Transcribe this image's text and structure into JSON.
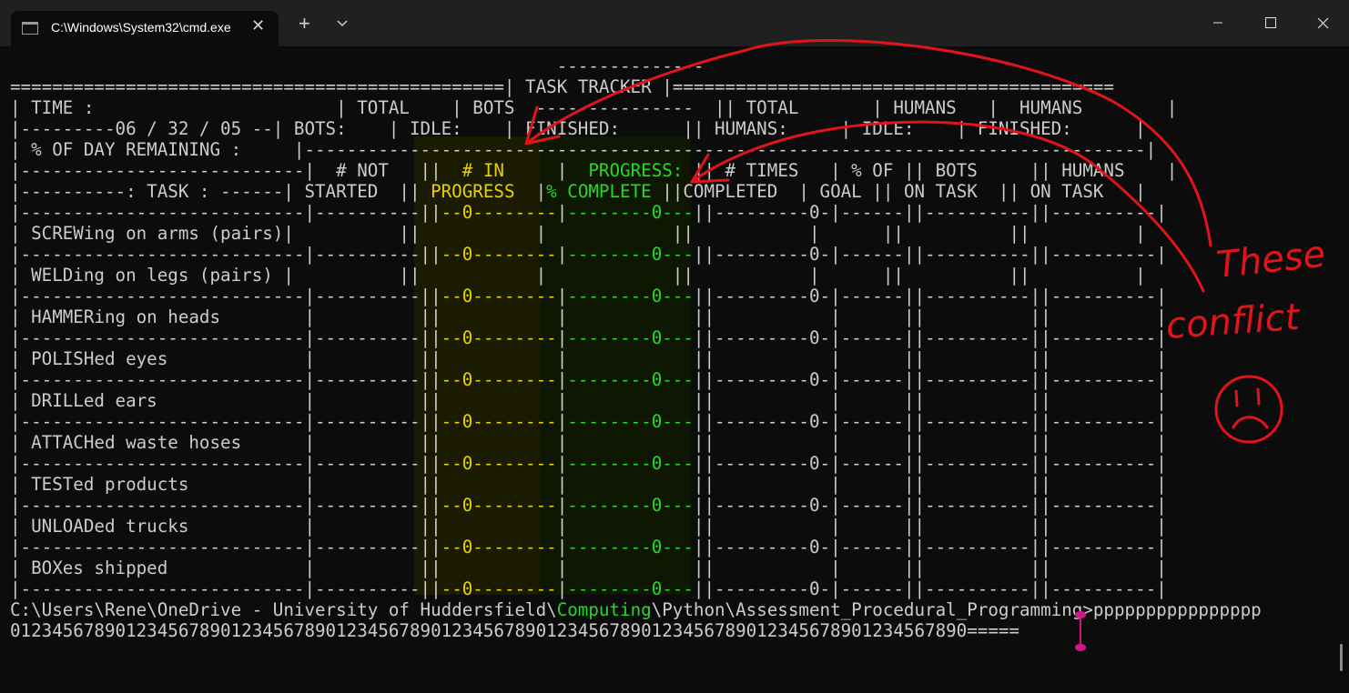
{
  "window": {
    "tab_title": "C:\\Windows\\System32\\cmd.exe",
    "tab_close": "✕",
    "new_tab": "+"
  },
  "terminal": {
    "lines": [
      [
        {
          "t": "                                                    --------------"
        }
      ],
      [
        {
          "t": "===============================================| TASK TRACKER |=========================================="
        }
      ],
      [
        {
          "t": "| TIME :                       | TOTAL    | BOTS  ---------------  || TOTAL       | HUMANS   |  HUMANS        |"
        }
      ],
      [
        {
          "t": "|---------06 / 32 / 05 --| BOTS:    | IDLE:    | FINISHED:      || HUMANS:     | IDLE:    | FINISHED:      |"
        }
      ],
      [
        {
          "t": "| % OF DAY REMAINING :     |--------------------------------------------------------------------------------|"
        }
      ],
      [
        {
          "t": "|---------------------------|  # NOT   ||",
          "c": ""
        },
        {
          "t": "  # IN     ",
          "c": "y"
        },
        {
          "t": "|"
        },
        {
          "t": "  PROGRESS: ",
          "c": "g"
        },
        {
          "t": "|| # TIMES   | % OF || BOTS     || HUMANS    |"
        }
      ],
      [
        {
          "t": "|----------: TASK : ------| STARTED  ||",
          "c": ""
        },
        {
          "t": " PROGRESS  ",
          "c": "y"
        },
        {
          "t": "|"
        },
        {
          "t": "% COMPLETE ",
          "c": "g"
        },
        {
          "t": "||COMPLETED  | GOAL || ON TASK  || ON TASK   |"
        }
      ],
      [
        {
          "t": "|---------------------------|----------||"
        },
        {
          "t": "--0--------",
          "c": "y"
        },
        {
          "t": "|"
        },
        {
          "t": "--------0---",
          "c": "g"
        },
        {
          "t": "||---------0-|------||----------||----------|"
        }
      ],
      [
        {
          "t": "| SCREWing on arms (pairs)|          ||"
        },
        {
          "t": "           ",
          "c": "y"
        },
        {
          "t": "|"
        },
        {
          "t": "            ",
          "c": "g"
        },
        {
          "t": "||           |      ||          ||          |"
        }
      ],
      [
        {
          "t": "|---------------------------|----------||"
        },
        {
          "t": "--0--------",
          "c": "y"
        },
        {
          "t": "|"
        },
        {
          "t": "--------0---",
          "c": "g"
        },
        {
          "t": "||---------0-|------||----------||----------|"
        }
      ],
      [
        {
          "t": "| WELDing on legs (pairs) |          ||"
        },
        {
          "t": "           ",
          "c": "y"
        },
        {
          "t": "|"
        },
        {
          "t": "            ",
          "c": "g"
        },
        {
          "t": "||           |      ||          ||          |"
        }
      ],
      [
        {
          "t": "|---------------------------|----------||"
        },
        {
          "t": "--0--------",
          "c": "y"
        },
        {
          "t": "|"
        },
        {
          "t": "--------0---",
          "c": "g"
        },
        {
          "t": "||---------0-|------||----------||----------|"
        }
      ],
      [
        {
          "t": "| HAMMERing on heads        |          ||"
        },
        {
          "t": "           ",
          "c": "y"
        },
        {
          "t": "|"
        },
        {
          "t": "            ",
          "c": "g"
        },
        {
          "t": "||           |      ||          ||          |"
        }
      ],
      [
        {
          "t": "|---------------------------|----------||"
        },
        {
          "t": "--0--------",
          "c": "y"
        },
        {
          "t": "|"
        },
        {
          "t": "--------0---",
          "c": "g"
        },
        {
          "t": "||---------0-|------||----------||----------|"
        }
      ],
      [
        {
          "t": "| POLISHed eyes             |          ||"
        },
        {
          "t": "           ",
          "c": "y"
        },
        {
          "t": "|"
        },
        {
          "t": "            ",
          "c": "g"
        },
        {
          "t": "||           |      ||          ||          |"
        }
      ],
      [
        {
          "t": "|---------------------------|----------||"
        },
        {
          "t": "--0--------",
          "c": "y"
        },
        {
          "t": "|"
        },
        {
          "t": "--------0---",
          "c": "g"
        },
        {
          "t": "||---------0-|------||----------||----------|"
        }
      ],
      [
        {
          "t": "| DRILLed ears              |          ||"
        },
        {
          "t": "           ",
          "c": "y"
        },
        {
          "t": "|"
        },
        {
          "t": "            ",
          "c": "g"
        },
        {
          "t": "||           |      ||          ||          |"
        }
      ],
      [
        {
          "t": "|---------------------------|----------||"
        },
        {
          "t": "--0--------",
          "c": "y"
        },
        {
          "t": "|"
        },
        {
          "t": "--------0---",
          "c": "g"
        },
        {
          "t": "||---------0-|------||----------||----------|"
        }
      ],
      [
        {
          "t": "| ATTACHed waste hoses      |          ||"
        },
        {
          "t": "           ",
          "c": "y"
        },
        {
          "t": "|"
        },
        {
          "t": "            ",
          "c": "g"
        },
        {
          "t": "||           |      ||          ||          |"
        }
      ],
      [
        {
          "t": "|---------------------------|----------||"
        },
        {
          "t": "--0--------",
          "c": "y"
        },
        {
          "t": "|"
        },
        {
          "t": "--------0---",
          "c": "g"
        },
        {
          "t": "||---------0-|------||----------||----------|"
        }
      ],
      [
        {
          "t": "| TESTed products           |          ||"
        },
        {
          "t": "           ",
          "c": "y"
        },
        {
          "t": "|"
        },
        {
          "t": "            ",
          "c": "g"
        },
        {
          "t": "||           |      ||          ||          |"
        }
      ],
      [
        {
          "t": "|---------------------------|----------||"
        },
        {
          "t": "--0--------",
          "c": "y"
        },
        {
          "t": "|"
        },
        {
          "t": "--------0---",
          "c": "g"
        },
        {
          "t": "||---------0-|------||----------||----------|"
        }
      ],
      [
        {
          "t": "| UNLOADed trucks           |          ||"
        },
        {
          "t": "           ",
          "c": "y"
        },
        {
          "t": "|"
        },
        {
          "t": "            ",
          "c": "g"
        },
        {
          "t": "||           |      ||          ||          |"
        }
      ],
      [
        {
          "t": "|---------------------------|----------||"
        },
        {
          "t": "--0--------",
          "c": "y"
        },
        {
          "t": "|"
        },
        {
          "t": "--------0---",
          "c": "g"
        },
        {
          "t": "||---------0-|------||----------||----------|"
        }
      ],
      [
        {
          "t": "| BOXes shipped             |          ||"
        },
        {
          "t": "           ",
          "c": "y"
        },
        {
          "t": "|"
        },
        {
          "t": "            ",
          "c": "g"
        },
        {
          "t": "||           |      ||          ||          |"
        }
      ],
      [
        {
          "t": "|---------------------------|----------||"
        },
        {
          "t": "--0--------",
          "c": "y"
        },
        {
          "t": "|"
        },
        {
          "t": "--------0---",
          "c": "g"
        },
        {
          "t": "||---------0-|------||----------||----------|"
        }
      ],
      [
        {
          "t": "C:\\Users\\Rene\\OneDrive - University of Huddersfield\\"
        },
        {
          "t": "Computing",
          "c": "g"
        },
        {
          "t": "\\"
        },
        {
          "t": "Python\\Assessment_Procedural_Programming>pppppppppppppppp"
        }
      ],
      [
        {
          "t": "0123456789012345678901234567890123456789012345678901234567890123456789012345678901234567890====="
        }
      ]
    ]
  },
  "annotation": {
    "text_line1": "These",
    "text_line2": "conflict",
    "color": "#e0141a"
  },
  "colors": {
    "in_progress": "#e6d200",
    "progress_complete": "#2ad62a",
    "terminal_text": "#cccccc",
    "cursor": "#d4148a"
  }
}
